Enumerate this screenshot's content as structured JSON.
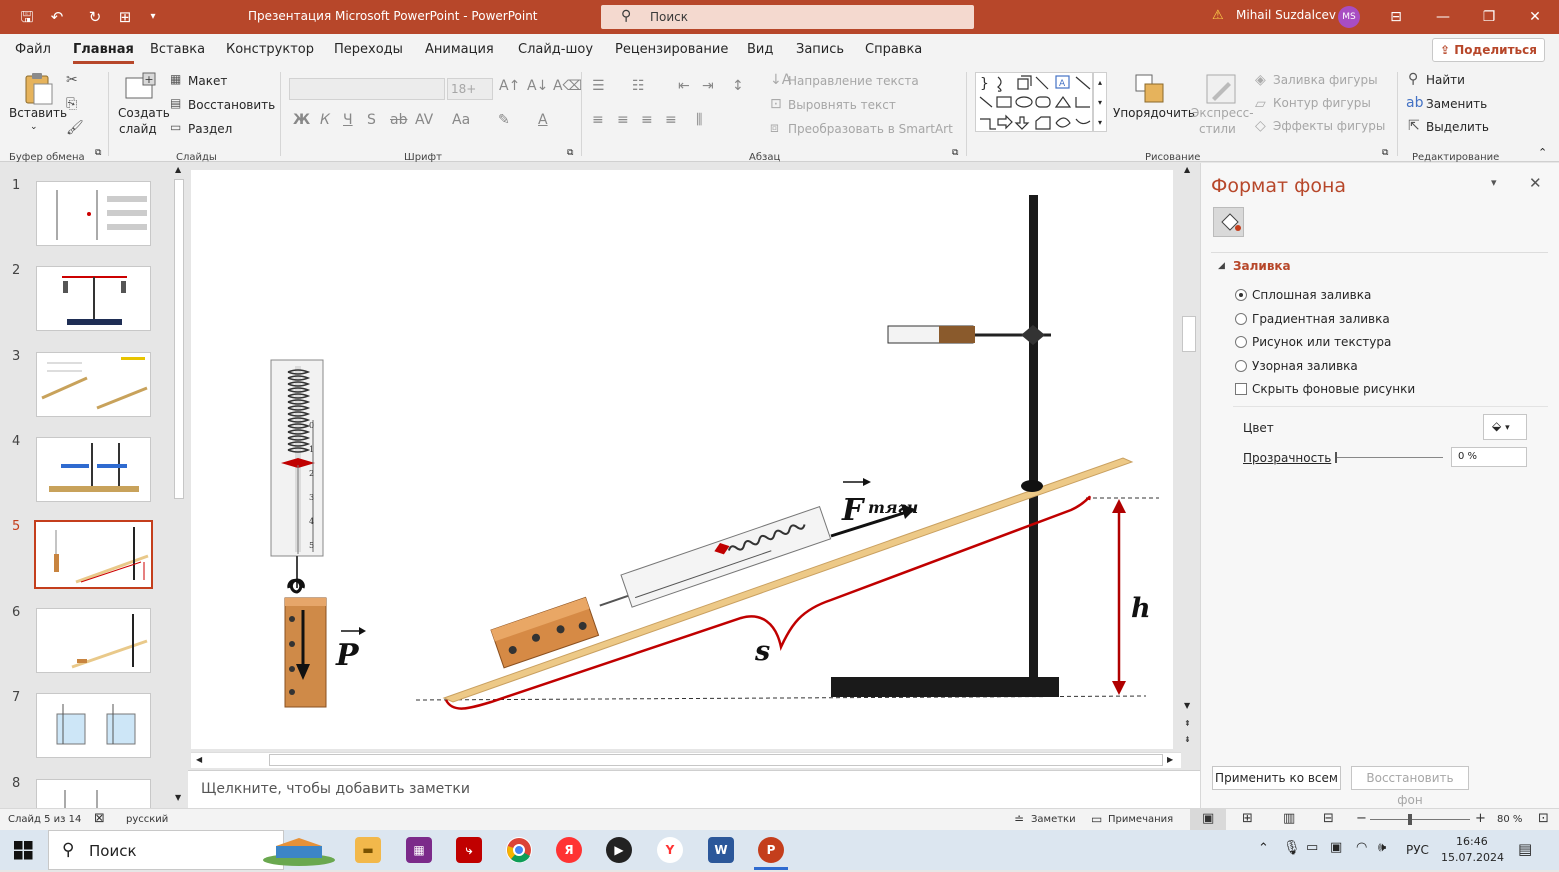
{
  "titlebar": {
    "title": "Презентация Microsoft PowerPoint  -  PowerPoint",
    "search_placeholder": "Поиск",
    "user_name": "Mihail Suzdalcev",
    "user_initials": "MS",
    "accent": "#b7472a"
  },
  "tabs": [
    "Файл",
    "Главная",
    "Вставка",
    "Конструктор",
    "Переходы",
    "Анимация",
    "Слайд-шоу",
    "Рецензирование",
    "Вид",
    "Запись",
    "Справка"
  ],
  "share_label": "Поделиться",
  "ribbon": {
    "clipboard": {
      "paste": "Вставить",
      "group": "Буфер обмена"
    },
    "slides": {
      "new_slide_1": "Создать",
      "new_slide_2": "слайд",
      "layout": "Макет",
      "reset": "Восстановить",
      "section": "Раздел",
      "group": "Слайды"
    },
    "font": {
      "size": "18+",
      "group": "Шрифт"
    },
    "paragraph": {
      "text_dir": "Направление текста",
      "align_text": "Выровнять текст",
      "smartart": "Преобразовать в SmartArt",
      "group": "Абзац"
    },
    "drawing": {
      "arrange": "Упорядочить",
      "quick_styles_1": "Экспресс-",
      "quick_styles_2": "стили",
      "shape_fill": "Заливка фигуры",
      "shape_outline": "Контур фигуры",
      "shape_effects": "Эффекты фигуры",
      "group": "Рисование"
    },
    "editing": {
      "find": "Найти",
      "replace": "Заменить",
      "select": "Выделить",
      "group": "Редактирование"
    }
  },
  "slides_panel": {
    "numbers": [
      "1",
      "2",
      "3",
      "4",
      "5",
      "6",
      "7",
      "8"
    ],
    "selected": "5"
  },
  "slide": {
    "label_p": "P",
    "label_f": "F",
    "label_f_sub": "тяги",
    "label_s": "s",
    "label_h": "h",
    "dyn_ticks": [
      "0",
      "1",
      "2",
      "3",
      "4",
      "5"
    ]
  },
  "notes_placeholder": "Щелкните, чтобы добавить заметки",
  "format_pane": {
    "title": "Формат фона",
    "section": "Заливка",
    "options": [
      "Сплошная заливка",
      "Градиентная заливка",
      "Рисунок или текстура",
      "Узорная заливка"
    ],
    "selected_option": "Сплошная заливка",
    "hide_bg_label": "Скрыть фоновые рисунки",
    "color_label": "Цвет",
    "transparency_label": "Прозрачность",
    "transparency_value": "0 %",
    "apply_all": "Применить ко всем",
    "reset_bg": "Восстановить фон"
  },
  "status": {
    "slide_info": "Слайд 5 из 14",
    "language": "русский",
    "notes": "Заметки",
    "comments": "Примечания",
    "zoom": "80 %"
  },
  "taskbar": {
    "search": "Поиск",
    "lang": "РУС",
    "time": "16:46",
    "date": "15.07.2024"
  }
}
